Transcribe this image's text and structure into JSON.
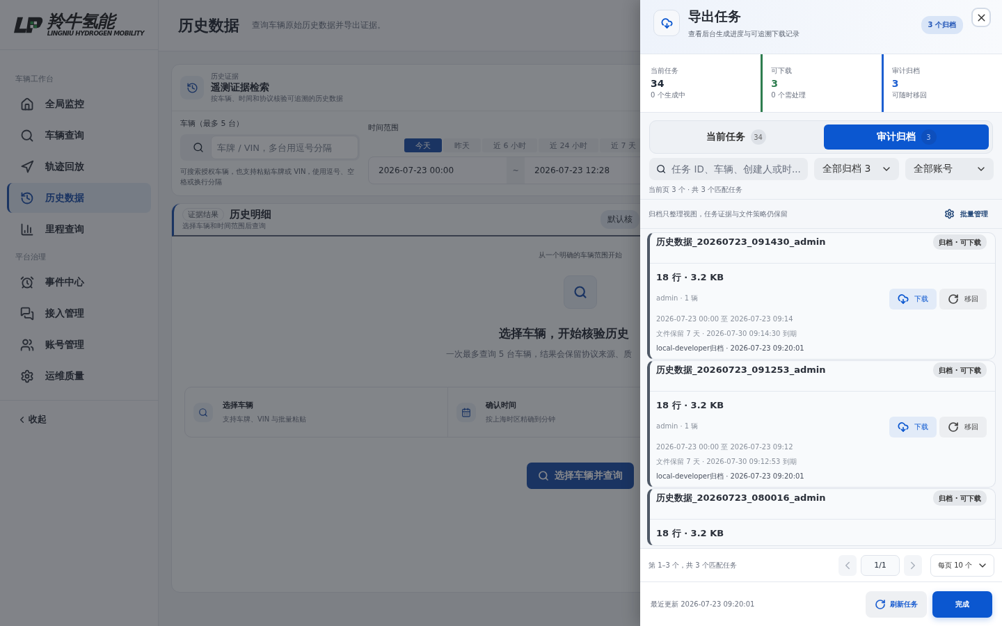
{
  "sidebar": {
    "logo": {
      "name": "羚牛氢能",
      "tagline": "LINGNIU HYDROGEN MOBILITY"
    },
    "sections": [
      {
        "title": "车辆工作台",
        "items": [
          {
            "label": "全局监控",
            "kind": "home",
            "selected": false
          },
          {
            "label": "车辆查询",
            "kind": "search",
            "selected": false
          },
          {
            "label": "轨迹回放",
            "kind": "route",
            "selected": false
          },
          {
            "label": "历史数据",
            "kind": "history",
            "selected": true
          },
          {
            "label": "里程查询",
            "kind": "chart",
            "selected": false
          }
        ]
      },
      {
        "title": "平台治理",
        "items": [
          {
            "label": "事件中心",
            "kind": "alarm",
            "selected": false
          },
          {
            "label": "接入管理",
            "kind": "messages",
            "selected": false
          },
          {
            "label": "账号管理",
            "kind": "users",
            "selected": false
          },
          {
            "label": "运维质量",
            "kind": "settings",
            "selected": false
          }
        ]
      }
    ],
    "collapse": "收起"
  },
  "page": {
    "title": "历史数据",
    "subtitle": "查询车辆原始历史数据并导出证据。"
  },
  "search_card": {
    "eyebrow": "历史证据",
    "title": "遥测证据检索",
    "subtitle": "按车辆、时间和协议核验可追溯的历史数据",
    "vehicle_label": "车辆（最多 5 台）",
    "vehicle_placeholder": "车牌 / VIN，多台用逗号分隔",
    "vehicle_hint": "可搜索授权车辆，也支持粘贴车牌或 VIN，使用逗号、空格或换行分隔",
    "time_label": "时间范围",
    "presets": [
      {
        "label": "今天",
        "selected": true
      },
      {
        "label": "昨天",
        "selected": false
      },
      {
        "label": "近 6 小时",
        "selected": false
      },
      {
        "label": "近 24 小时",
        "selected": false
      },
      {
        "label": "近 7 天",
        "selected": false
      }
    ],
    "start": "2026-07-23 00:00",
    "separator": "~",
    "end": "2026-07-23 12:28"
  },
  "results": {
    "tag": "证据结果",
    "title": "历史明细",
    "subtitle": "选择车辆和时间范围后查询",
    "badge": "默认核",
    "eyebrow": "从一个明确的车辆范围开始",
    "heading": "选择车辆，开始核验历史",
    "description": "一次最多查询 5 台车辆，结果会保留协议来源、质",
    "steps": [
      {
        "kind": "search",
        "title": "选择车辆",
        "text": "支持车牌、VIN 与批量粘贴"
      },
      {
        "kind": "calendar",
        "title": "确认时间",
        "text": "按上海时区精确到分钟"
      }
    ],
    "action": "选择车辆并查询"
  },
  "drawer": {
    "title": "导出任务",
    "subtitle": "查看后台生成进度与可追溯下载记录",
    "badge": "3 个归档",
    "stats": [
      {
        "kind": "plain",
        "label": "当前任务",
        "value": "34",
        "note": "0 个生成中",
        "color": "#1f2937"
      },
      {
        "kind": "accent",
        "label": "可下载",
        "value": "3",
        "note": "0 个需处理",
        "color": "#2e7d4f"
      },
      {
        "kind": "accent",
        "label": "审计归档",
        "value": "3",
        "note": "可随时移回",
        "color": "#1d5fd1"
      }
    ],
    "tabs": [
      {
        "label": "当前任务",
        "count": "34",
        "selected": false
      },
      {
        "label": "审计归档",
        "count": "3",
        "selected": true
      }
    ],
    "search_placeholder": "任务 ID、车辆、创建人或时...",
    "filters": [
      "全部归档 3",
      "全部账号"
    ],
    "match_count": "当前页 3 个 · 共 3 个匹配任务",
    "note": "归档只整理视图，任务证据与文件策略仍保留",
    "bulk": "批量管理",
    "tasks": [
      {
        "title": "历史数据_20260723_091430_admin",
        "status": "归档 · 可下载",
        "size": "18 行 · 3.2 KB",
        "meta": "admin · 1 辆",
        "range": "2026-07-23 00:00 至 2026-07-23 09:14",
        "retention": "文件保留 7 天 · 2026-07-30 09:14:30 到期",
        "archived": "local-developer归档 · 2026-07-23 09:20:01",
        "actions": [
          {
            "kind": "download",
            "label": "下载"
          },
          {
            "kind": "restore",
            "label": "移回"
          }
        ]
      },
      {
        "title": "历史数据_20260723_091253_admin",
        "status": "归档 · 可下载",
        "size": "18 行 · 3.2 KB",
        "meta": "admin · 1 辆",
        "range": "2026-07-23 00:00 至 2026-07-23 09:12",
        "retention": "文件保留 7 天 · 2026-07-30 09:12:53 到期",
        "archived": "local-developer归档 · 2026-07-23 09:20:01",
        "actions": [
          {
            "kind": "download",
            "label": "下载"
          },
          {
            "kind": "restore",
            "label": "移回"
          }
        ]
      },
      {
        "title": "历史数据_20260723_080016_admin",
        "status": "归档 · 可下载",
        "size": "18 行 · 3.2 KB"
      }
    ],
    "pagination": {
      "summary": "第 1–3 个，共 3 个匹配任务",
      "page": "1/1",
      "prev_disabled": true,
      "next_disabled": true,
      "page_size": "每页 10 个"
    },
    "updated": "最近更新 2026-07-23 09:20:01",
    "refresh": "刷新任务",
    "done": "完成"
  }
}
